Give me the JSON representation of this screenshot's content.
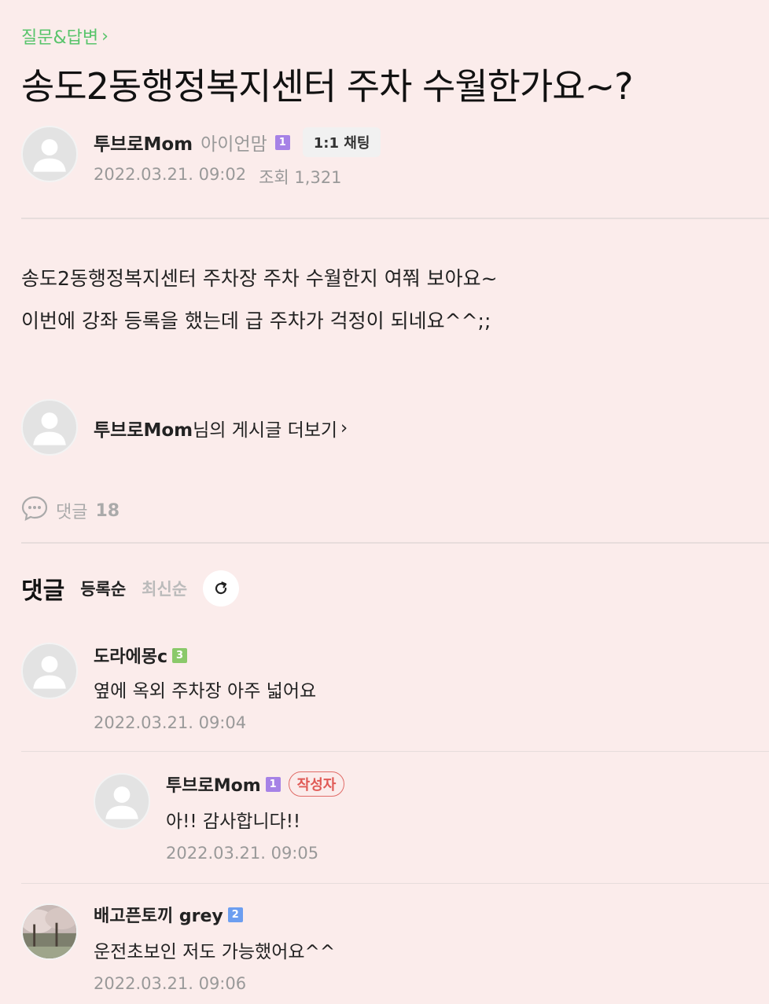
{
  "board": {
    "name": "질문&답변"
  },
  "post": {
    "title": "송도2동행정복지센터 주차 수월한가요~?",
    "author": {
      "nickname": "투브로Mom",
      "sub_nick": "아이언맘",
      "level": "1"
    },
    "chat_button": "1:1 채팅",
    "date": "2022.03.21. 09:02",
    "views": "조회 1,321",
    "body_lines": [
      "송도2동행정복지센터 주차장 주차 수월한지 여쭤 보아요~",
      "이번에 강좌 등록을 했는데 급 주차가 걱정이 되네요^^;;"
    ]
  },
  "more_posts": {
    "author": "투브로Mom",
    "suffix": "님의 게시글 더보기"
  },
  "comment_summary": {
    "label": "댓글",
    "count": "18"
  },
  "comments_section": {
    "title": "댓글",
    "sort_options": [
      "등록순",
      "최신순"
    ],
    "items": [
      {
        "nickname": "도라에몽c",
        "level": "3",
        "text": "옆에 옥외 주차장 아주 넓어요",
        "date": "2022.03.21. 09:04"
      },
      {
        "nickname": "투브로Mom",
        "level": "1",
        "badge": "작성자",
        "text": "아!! 감사합니다!!",
        "date": "2022.03.21. 09:05",
        "reply": true
      },
      {
        "nickname": "배고픈토끼 grey",
        "level": "2",
        "text": "운전초보인 저도 가능했어요^^",
        "date": "2022.03.21. 09:06"
      }
    ]
  },
  "colors": {
    "background": "#fbeceb",
    "board_link": "#58c46b",
    "writer_badge": "#e05a56"
  }
}
